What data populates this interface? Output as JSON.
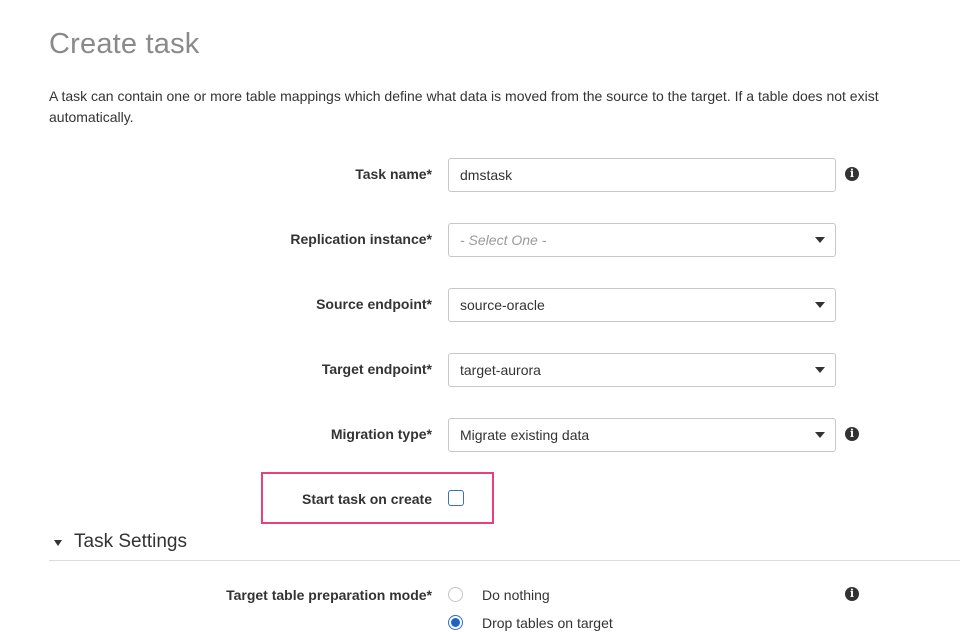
{
  "page": {
    "title": "Create task",
    "description_line1": "A task can contain one or more table mappings which define what data is moved from the source to the target. If a table does not exist",
    "description_line2": "automatically."
  },
  "form": {
    "task_name": {
      "label": "Task name*",
      "value": "dmstask"
    },
    "replication_instance": {
      "label": "Replication instance*",
      "value": "- Select One -"
    },
    "source_endpoint": {
      "label": "Source endpoint*",
      "value": "source-oracle"
    },
    "target_endpoint": {
      "label": "Target endpoint*",
      "value": "target-aurora"
    },
    "migration_type": {
      "label": "Migration type*",
      "value": "Migrate existing data"
    },
    "start_task": {
      "label": "Start task on create",
      "checked": false
    }
  },
  "task_settings": {
    "title": "Task Settings",
    "target_table_prep": {
      "label": "Target table preparation mode*",
      "options": [
        "Do nothing",
        "Drop tables on target"
      ],
      "selected": "Drop tables on target"
    }
  },
  "icons": {
    "info": "info-icon",
    "caret": "caret-down-icon"
  },
  "colors": {
    "highlight": "#e8407a",
    "radio_selected": "#1f63c6",
    "title": "#8a8a8a"
  }
}
